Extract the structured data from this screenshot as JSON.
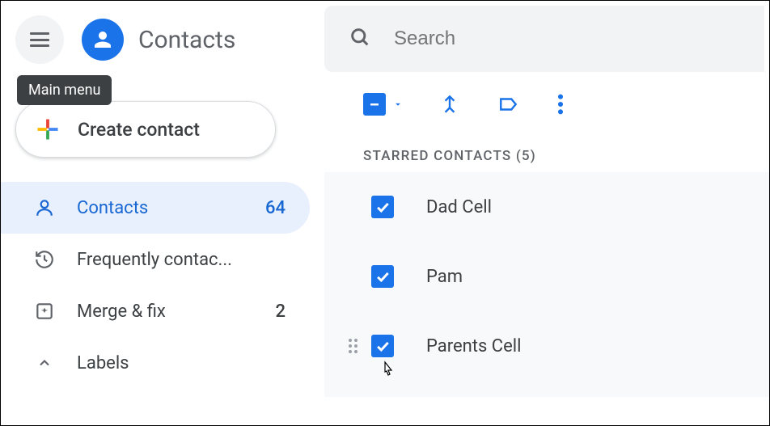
{
  "header": {
    "app_title": "Contacts",
    "tooltip": "Main menu"
  },
  "create_button": {
    "label": "Create contact"
  },
  "sidebar": {
    "items": [
      {
        "label": "Contacts",
        "count": "64",
        "active": true
      },
      {
        "label": "Frequently contac...",
        "count": "",
        "active": false
      },
      {
        "label": "Merge & fix",
        "count": "2",
        "active": false
      }
    ],
    "labels_header": "Labels"
  },
  "search": {
    "placeholder": "Search",
    "value": ""
  },
  "section": {
    "starred_header": "STARRED CONTACTS (5)"
  },
  "contacts": [
    {
      "name": "Dad Cell",
      "checked": true,
      "hovered": false
    },
    {
      "name": "Pam",
      "checked": true,
      "hovered": false
    },
    {
      "name": "Parents Cell",
      "checked": true,
      "hovered": true
    }
  ],
  "colors": {
    "primary": "#1a73e8",
    "text_secondary": "#5f6368"
  }
}
